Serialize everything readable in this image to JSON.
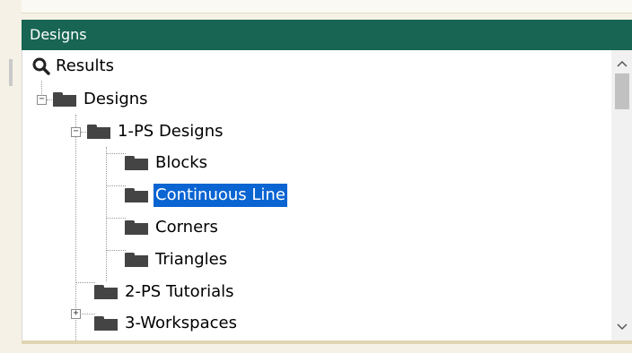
{
  "panel": {
    "title": "Designs"
  },
  "tree": {
    "results_label": "Results",
    "designs_label": "Designs",
    "ps_designs_label": "1-PS Designs",
    "blocks_label": "Blocks",
    "continuous_line_label": "Continuous Line",
    "corners_label": "Corners",
    "triangles_label": "Triangles",
    "ps_tutorials_label": "2-PS Tutorials",
    "workspaces_label": "3-Workspaces",
    "selected_item": "Continuous Line"
  },
  "icons": {
    "results": "magnifier-icon",
    "folder": "folder-icon",
    "expand": "plus-box-icon",
    "collapse": "minus-box-icon",
    "scroll_up": "chevron-up-icon",
    "scroll_down": "chevron-down-icon"
  },
  "colors": {
    "header_bg": "#176552",
    "selection_bg": "#0a64d2",
    "folder": "#444444"
  }
}
